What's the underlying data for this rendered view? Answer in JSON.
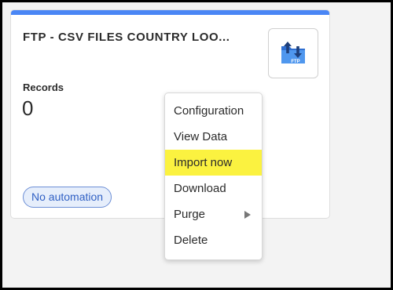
{
  "card": {
    "title": "FTP - CSV FILES COUNTRY LOO...",
    "icon": "ftp-folder-transfer-icon",
    "accent_color": "#4a86f5",
    "records_label": "Records",
    "records_value": "0",
    "badge": "No automation",
    "icon_text": "FTP"
  },
  "menu": {
    "items": [
      {
        "label": "Configuration"
      },
      {
        "label": "View Data"
      },
      {
        "label": "Import now",
        "highlighted": true,
        "highlight_color": "#fbf240"
      },
      {
        "label": "Download"
      },
      {
        "label": "Purge",
        "has_submenu": true
      },
      {
        "label": "Delete"
      }
    ]
  }
}
